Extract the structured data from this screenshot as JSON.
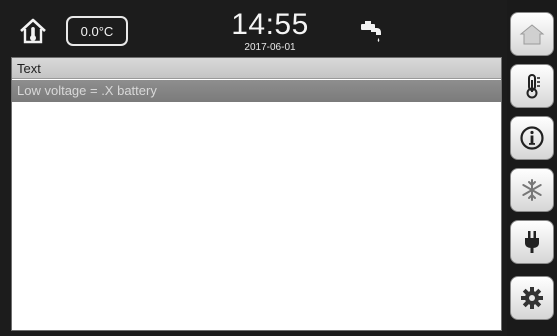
{
  "status_bar": {
    "temperature": "0.0°C",
    "time": "14:55",
    "date": "2017-06-01"
  },
  "messages": {
    "header": "Text",
    "items": [
      "Low voltage = .X battery"
    ]
  },
  "icons": {
    "home": "home-thermometer-icon",
    "tap": "water-tap-icon",
    "sidebar": [
      "home-icon",
      "thermometer-icon",
      "info-icon",
      "snowflake-icon",
      "power-plug-icon",
      "gear-icon"
    ]
  },
  "colors": {
    "background": "#1c1c1c",
    "header_row": "#cfcfcf",
    "selected_row": "#858585",
    "button_face": "#f0f0f0"
  }
}
